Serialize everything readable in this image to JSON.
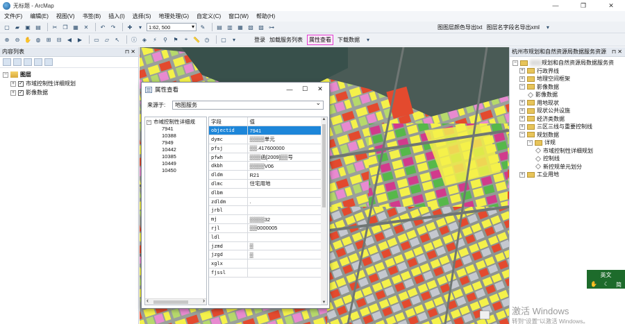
{
  "window": {
    "title": "无标题 - ArcMap",
    "controls": [
      "—",
      "❐",
      "✕"
    ]
  },
  "menu": [
    "文件(F)",
    "编辑(E)",
    "视图(V)",
    "书签(B)",
    "插入(I)",
    "选择(S)",
    "地理处理(G)",
    "自定义(C)",
    "窗口(W)",
    "帮助(H)"
  ],
  "toolbar": {
    "scale_value": "1:62, 500",
    "export_color_btn": "图图层颜色导出txt",
    "export_field_btn": "图层名字段名导出xml",
    "login_btn": "登录",
    "load_services_btn": "加载服务列表",
    "attribute_view_btn": "属性查看",
    "download_btn": "下载数据"
  },
  "toc": {
    "title": "内容列表",
    "pin": "⊓ ✕",
    "root": "图层",
    "layers": [
      "市域控制性详细规划",
      "影像数据"
    ]
  },
  "catalog": {
    "title": "杭州市规划和自然资源局数据服务资源",
    "pin": "⊓ ✕",
    "root_suffix": "规划和自然资源局数据服务资",
    "items": [
      {
        "label": "行政界线",
        "level": 1,
        "expanded": false
      },
      {
        "label": "地理空间框架",
        "level": 1,
        "expanded": false
      },
      {
        "label": "影像数据",
        "level": 1,
        "expanded": true
      },
      {
        "label": "影像数据",
        "level": 2,
        "leaf": true
      },
      {
        "label": "用地现状",
        "level": 1,
        "expanded": false
      },
      {
        "label": "现状公共设施",
        "level": 1,
        "expanded": false
      },
      {
        "label": "经济类数据",
        "level": 1,
        "expanded": false
      },
      {
        "label": "三区三线与重要控制线",
        "level": 1,
        "expanded": false
      },
      {
        "label": "规划数据",
        "level": 1,
        "expanded": true
      },
      {
        "label": "详规",
        "level": 2,
        "expanded": true
      },
      {
        "label": "市域控制性详细规划",
        "level": 3,
        "leaf": true
      },
      {
        "label": "控制线",
        "level": 3,
        "leaf": true
      },
      {
        "label": "新控规单元划分",
        "level": 3,
        "leaf": true
      },
      {
        "label": "工业用地",
        "level": 1,
        "expanded": false
      }
    ]
  },
  "dialog": {
    "title": "属性查看",
    "source_label": "来源于:",
    "source_value": "地图服务",
    "tree_root": "市域控制性详细规",
    "tree_children": [
      "7941",
      "10388",
      "7949",
      "10442",
      "10385",
      "10449",
      "10450"
    ],
    "columns": [
      "字段",
      "值"
    ],
    "rows": [
      {
        "field": "objectid",
        "value": "7941"
      },
      {
        "field": "dymc",
        "value": "▒▒▒▒单元"
      },
      {
        "field": "pfsj",
        "value": "▒▒.417600000"
      },
      {
        "field": "pfwh",
        "value": "▒▒▒函[2009]▒▒号"
      },
      {
        "field": "dkbh",
        "value": "▒▒▒▒V06"
      },
      {
        "field": "dldm",
        "value": "R21"
      },
      {
        "field": "dlmc",
        "value": "住宅用地"
      },
      {
        "field": "dlbm",
        "value": ""
      },
      {
        "field": "zdldm",
        "value": "."
      },
      {
        "field": "jrbl",
        "value": ""
      },
      {
        "field": "mj",
        "value": "▒▒▒▒32"
      },
      {
        "field": "rjl",
        "value": "▒▒0000005"
      },
      {
        "field": "ldl",
        "value": ""
      },
      {
        "field": "jzmd",
        "value": "▒"
      },
      {
        "field": "jzgd",
        "value": "▒"
      },
      {
        "field": "xglx",
        "value": ""
      },
      {
        "field": "fjssl",
        "value": ""
      }
    ]
  },
  "ime": {
    "lang": "英文",
    "mode": "简"
  },
  "watermark": {
    "line1": "激活 Windows",
    "line2": "转到\"设置\"以激活 Windows。"
  },
  "colors": {
    "selected_row": "#1d86d9",
    "active_button_border": "#e03ad0"
  }
}
